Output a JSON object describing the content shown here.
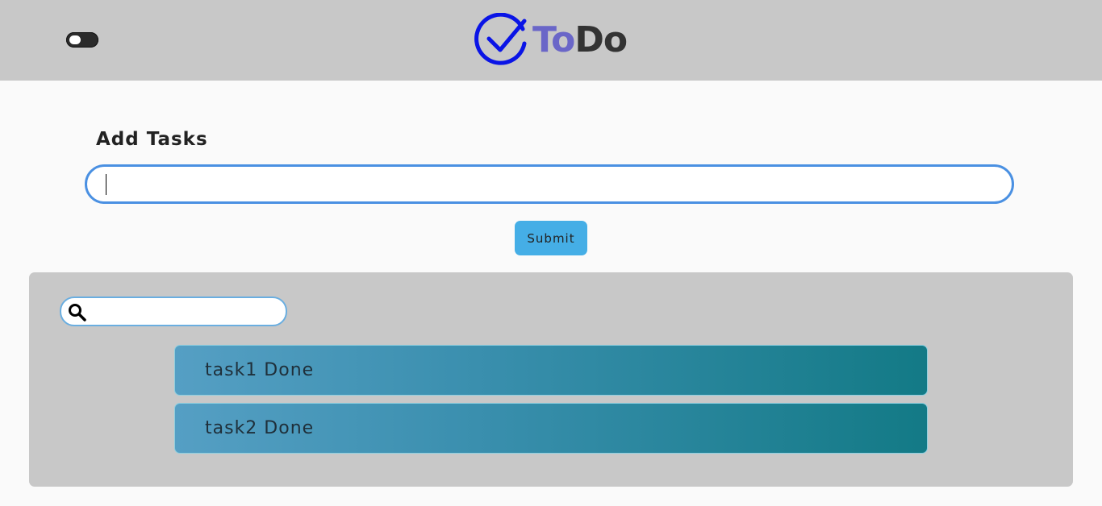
{
  "header": {
    "logo_to": "To",
    "logo_do": "Do",
    "theme_toggle_icon": "toggle-switch-icon",
    "logo_icon": "check-circle-icon"
  },
  "add_section": {
    "title": "Add Tasks",
    "input_value": "",
    "input_placeholder": "",
    "submit_label": "Submit"
  },
  "list_section": {
    "search_icon": "search-icon",
    "search_value": "",
    "search_placeholder": "",
    "tasks": [
      {
        "label": "task1 Done"
      },
      {
        "label": "task2 Done"
      }
    ]
  },
  "colors": {
    "header_bg": "#c8c8c8",
    "page_bg": "#fafafa",
    "accent_blue": "#4a90e2",
    "submit_bg": "#45aee6",
    "logo_to": "#6a66c8",
    "logo_check": "#0a14e6",
    "task_gradient_start": "#559fc4",
    "task_gradient_end": "#137a86"
  }
}
